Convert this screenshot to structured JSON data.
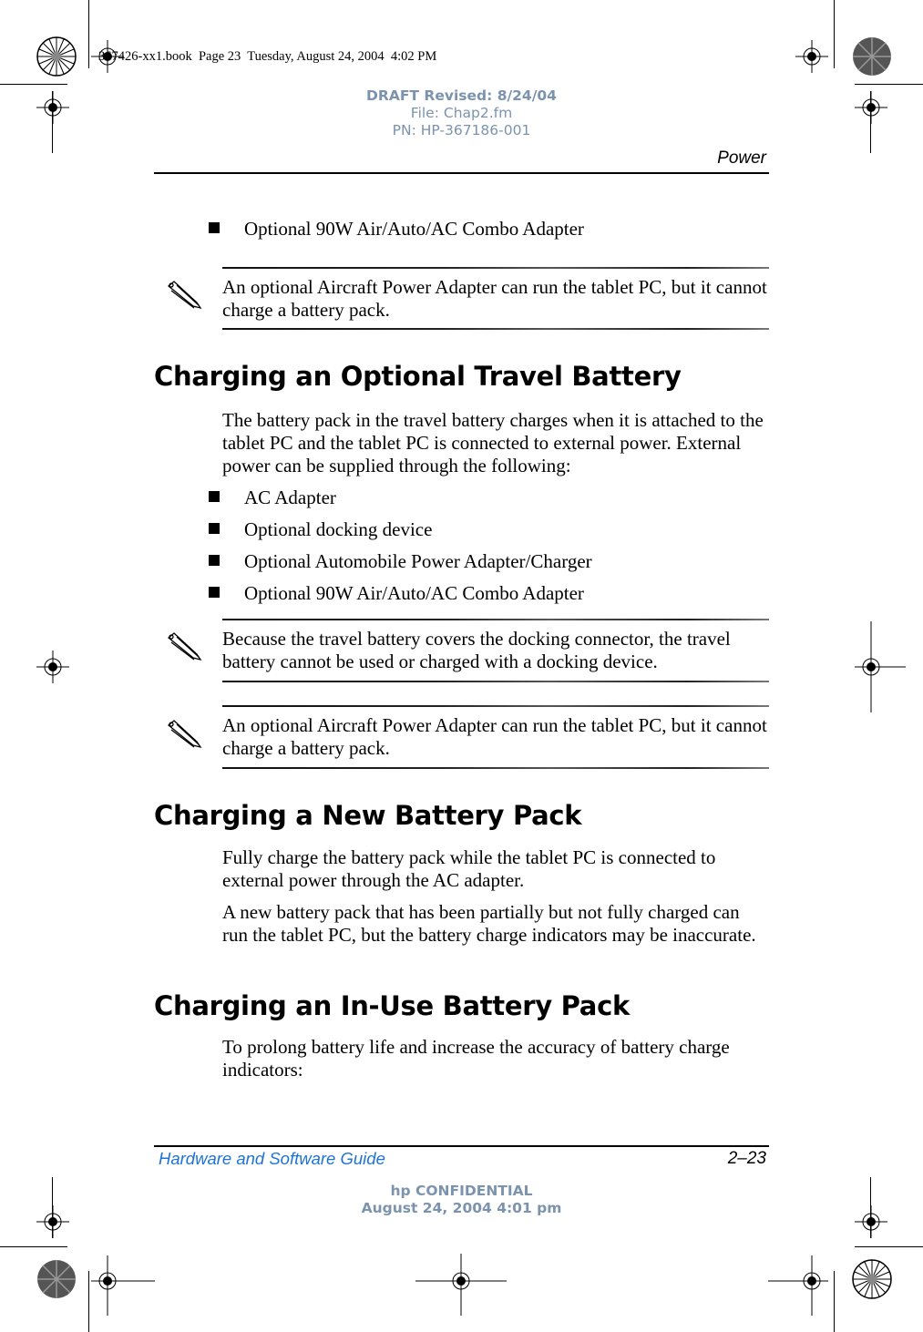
{
  "print_info": {
    "book_line": "367426-xx1.book  Page 23  Tuesday, August 24, 2004  4:02 PM"
  },
  "draft_stamp": {
    "line1": "DRAFT Revised: 8/24/04",
    "line2": "File: Chap2.fm",
    "line3": "PN: HP-367186-001"
  },
  "header": {
    "running_head": "Power"
  },
  "content": {
    "top_bullets": [
      "Optional 90W Air/Auto/AC Combo Adapter"
    ],
    "note1": "An optional Aircraft Power Adapter can run the tablet PC, but it cannot charge a battery pack.",
    "section1": {
      "title": "Charging an Optional Travel Battery",
      "para": "The battery pack in the travel battery charges when it is attached to the tablet PC and the tablet PC is connected to external power. External power can be supplied through the following:",
      "bullets": [
        "AC Adapter",
        "Optional docking device",
        "Optional Automobile Power Adapter/Charger",
        "Optional 90W Air/Auto/AC Combo Adapter"
      ],
      "note2": "Because the travel battery covers the docking connector, the travel battery cannot be used or charged with a docking device.",
      "note3": "An optional Aircraft Power Adapter can run the tablet PC, but it cannot charge a battery pack."
    },
    "section2": {
      "title": "Charging a New Battery Pack",
      "para1": "Fully charge the battery pack while the tablet PC is connected to external power through the AC adapter.",
      "para2": "A new battery pack that has been partially but not fully charged can run the tablet PC, but the battery charge indicators may be inaccurate."
    },
    "section3": {
      "title": "Charging an In-Use Battery Pack",
      "para": "To prolong battery life and increase the accuracy of battery charge indicators:"
    }
  },
  "footer": {
    "guide_title": "Hardware and Software Guide",
    "page_number": "2–23",
    "confidential_line1": "hp CONFIDENTIAL",
    "confidential_line2": "August 24, 2004 4:01 pm",
    "guide_color": "#1e73d6",
    "stamp_color": "#7b93ad"
  }
}
